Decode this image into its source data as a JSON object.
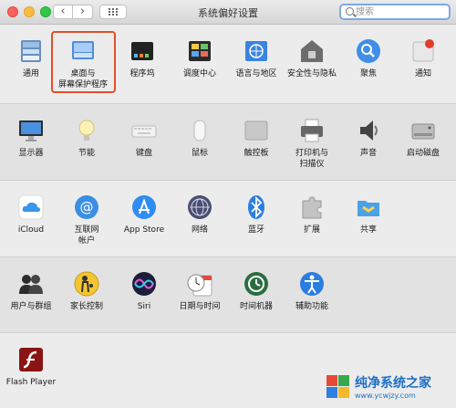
{
  "window": {
    "title": "系统偏好设置",
    "back_label": "‹",
    "forward_label": "›"
  },
  "search": {
    "placeholder": "搜索",
    "value": ""
  },
  "sections": [
    {
      "items": [
        {
          "label": "通用",
          "icon": "general-icon"
        },
        {
          "label": "桌面与\n屏幕保护程序",
          "icon": "desktop-screensaver-icon",
          "selected": true
        },
        {
          "label": "程序坞",
          "icon": "dock-icon"
        },
        {
          "label": "调度中心",
          "icon": "mission-control-icon"
        },
        {
          "label": "语言与地区",
          "icon": "language-region-icon"
        },
        {
          "label": "安全性与隐私",
          "icon": "security-privacy-icon"
        },
        {
          "label": "聚焦",
          "icon": "spotlight-icon"
        },
        {
          "label": "通知",
          "icon": "notifications-icon"
        }
      ]
    },
    {
      "items": [
        {
          "label": "显示器",
          "icon": "displays-icon"
        },
        {
          "label": "节能",
          "icon": "energy-saver-icon"
        },
        {
          "label": "键盘",
          "icon": "keyboard-icon"
        },
        {
          "label": "鼠标",
          "icon": "mouse-icon"
        },
        {
          "label": "触控板",
          "icon": "trackpad-icon"
        },
        {
          "label": "打印机与\n扫描仪",
          "icon": "printer-scanner-icon"
        },
        {
          "label": "声音",
          "icon": "sound-icon"
        },
        {
          "label": "启动磁盘",
          "icon": "startup-disk-icon"
        }
      ]
    },
    {
      "items": [
        {
          "label": "iCloud",
          "icon": "icloud-icon"
        },
        {
          "label": "互联网\n帐户",
          "icon": "internet-accounts-icon"
        },
        {
          "label": "App Store",
          "icon": "app-store-icon"
        },
        {
          "label": "网络",
          "icon": "network-icon"
        },
        {
          "label": "蓝牙",
          "icon": "bluetooth-icon"
        },
        {
          "label": "扩展",
          "icon": "extensions-icon"
        },
        {
          "label": "共享",
          "icon": "sharing-icon"
        }
      ]
    },
    {
      "items": [
        {
          "label": "用户与群组",
          "icon": "users-groups-icon"
        },
        {
          "label": "家长控制",
          "icon": "parental-controls-icon"
        },
        {
          "label": "Siri",
          "icon": "siri-icon"
        },
        {
          "label": "日期与时间",
          "icon": "date-time-icon"
        },
        {
          "label": "时间机器",
          "icon": "time-machine-icon"
        },
        {
          "label": "辅助功能",
          "icon": "accessibility-icon"
        }
      ]
    },
    {
      "items": [
        {
          "label": "Flash Player",
          "icon": "flash-player-icon"
        }
      ]
    }
  ],
  "watermark": {
    "title": "纯净系统之家",
    "url": "www.ycwjzy.com"
  }
}
